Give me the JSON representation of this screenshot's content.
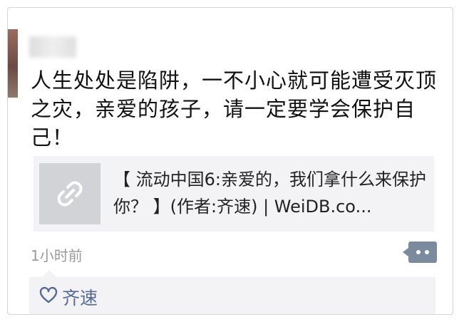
{
  "post": {
    "text": "人生处处是陷阱，一不小心就可能遭受灭顶之灾，亲爱的孩子，请一定要学会保护自己！",
    "link": {
      "title": "【 流动中国6:亲爱的，我们拿什么来保护你？ 】(作者:齐速) | WeiDB.co..."
    },
    "timestamp": "1小时前",
    "likes": {
      "names": "齐速"
    }
  },
  "icons": {
    "thumb": "link-chain-icon",
    "comment": "comment-dots-icon",
    "like": "heart-outline-icon"
  },
  "colors": {
    "liker_name": "#576b95",
    "comment_button": "#7c8a9e",
    "link_bg": "#f3f3f5"
  }
}
